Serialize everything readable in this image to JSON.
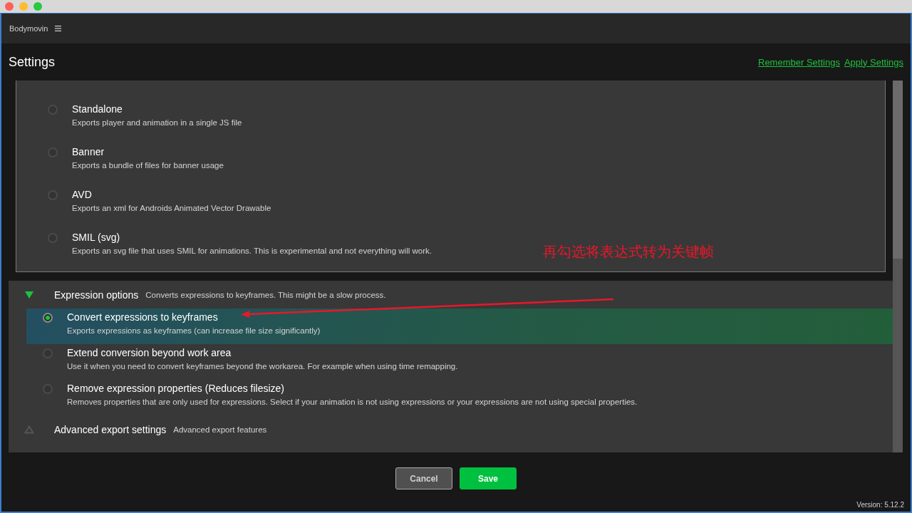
{
  "app": {
    "name": "Bodymovin"
  },
  "settings": {
    "title": "Settings",
    "links": [
      "Remember Settings",
      "Apply Settings"
    ]
  },
  "export_modes": [
    {
      "name": "Standalone",
      "description": "Exports player and animation in a single JS file",
      "selected": false
    },
    {
      "name": "Banner",
      "description": "Exports a bundle of files for banner usage",
      "selected": false
    },
    {
      "name": "AVD",
      "description": "Exports an xml for Androids Animated Vector Drawable",
      "selected": false
    },
    {
      "name": "SMIL (svg)",
      "description": "Exports an svg file that uses SMIL for animations. This is experimental and not everything will work.",
      "selected": false
    }
  ],
  "sections": [
    {
      "title": "Expression options",
      "description": "Converts expressions to keyframes. This might be a slow process.",
      "expanded": true,
      "options": [
        {
          "name": "Convert expressions to keyframes",
          "description": "Exports expressions as keyframes (can increase file size significantly)",
          "selected": true
        },
        {
          "name": "Extend conversion beyond work area",
          "description": "Use it when you need to convert keyframes beyond the workarea. For example when using time remapping.",
          "selected": false
        },
        {
          "name": "Remove expression properties (Reduces filesize)",
          "description": "Removes properties that are only used for expressions. Select if your animation is not using expressions or your expressions are not using special properties.",
          "selected": false
        }
      ]
    },
    {
      "title": "Advanced export settings",
      "description": "Advanced export features",
      "expanded": false
    }
  ],
  "buttons": [
    {
      "label": "Cancel",
      "kind": "secondary"
    },
    {
      "label": "Save",
      "kind": "primary"
    }
  ],
  "version": "Version: 5.12.2",
  "annotation": {
    "text": "再勾选将表达式转为关键帧"
  }
}
